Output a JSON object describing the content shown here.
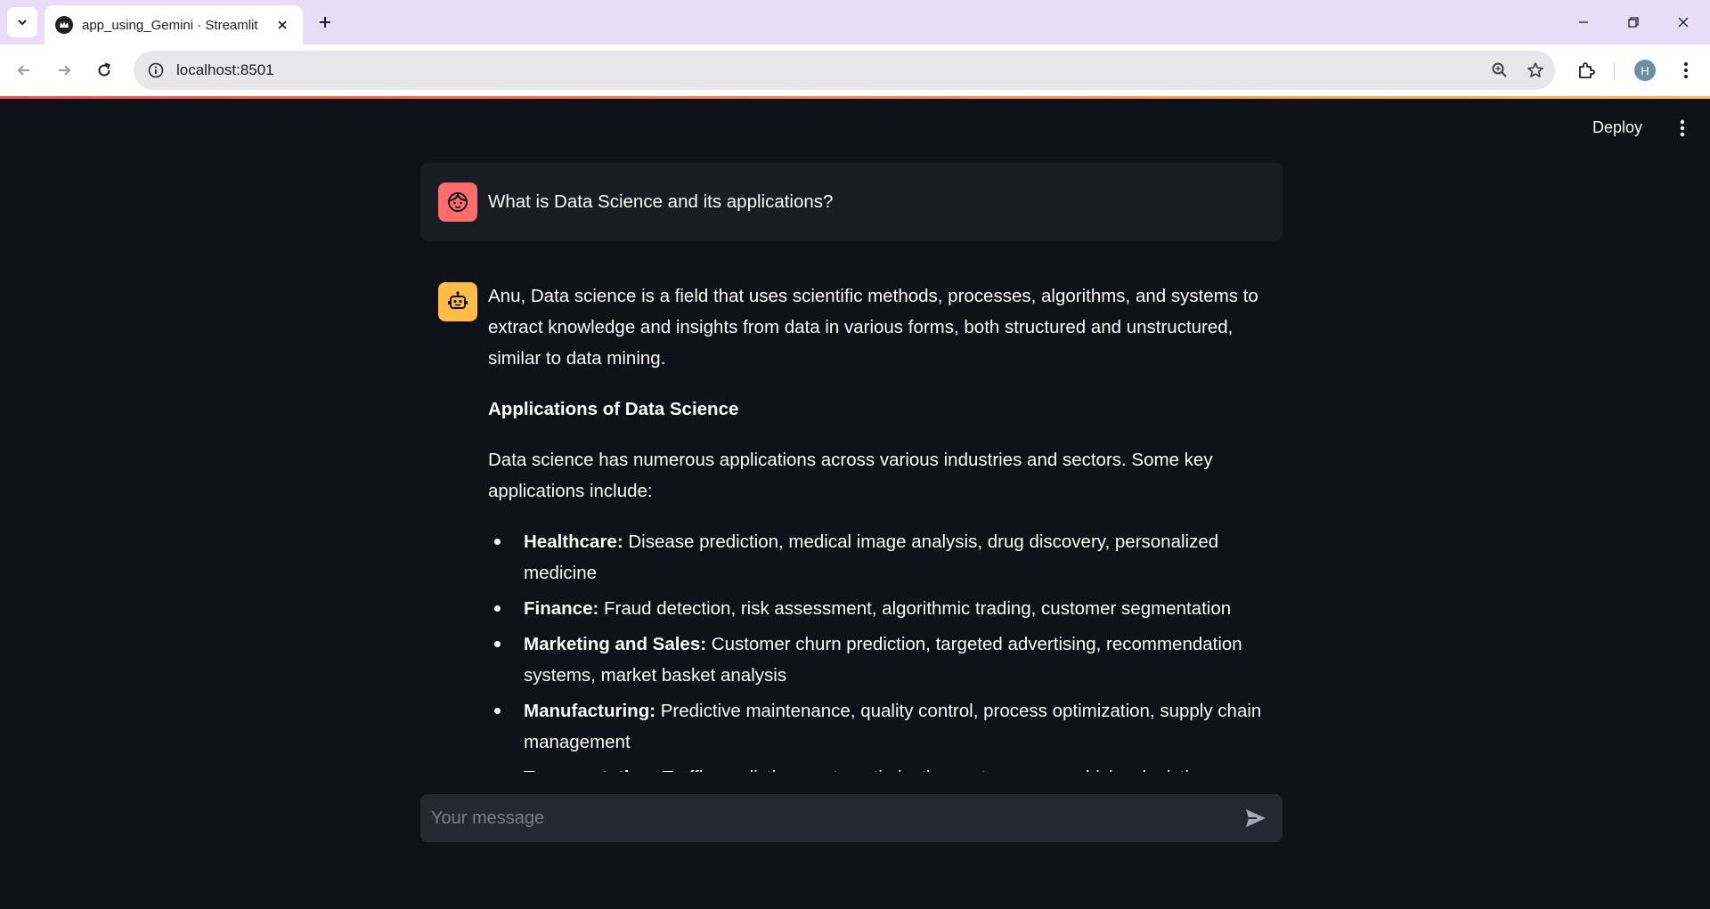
{
  "browser": {
    "tab_title": "app_using_Gemini · Streamlit",
    "url": "localhost:8501",
    "profile_initial": "H"
  },
  "app": {
    "deploy_label": "Deploy",
    "accent_gradient": [
      "#ff4b4b",
      "#ffbd45"
    ],
    "input_placeholder": "Your message"
  },
  "messages": {
    "user": {
      "text": "What is Data Science and its applications?",
      "avatar_icon": "user-face-icon",
      "avatar_color": "#ff6c6c"
    },
    "assistant": {
      "avatar_icon": "robot-icon",
      "avatar_color": "#ffbd45",
      "intro": "Anu, Data science is a field that uses scientific methods, processes, algorithms, and systems to extract knowledge and insights from data in various forms, both structured and unstructured, similar to data mining.",
      "heading": "Applications of Data Science",
      "para": "Data science has numerous applications across various industries and sectors. Some key applications include:",
      "items": [
        {
          "title": "Healthcare:",
          "text": " Disease prediction, medical image analysis, drug discovery, personalized medicine"
        },
        {
          "title": "Finance:",
          "text": " Fraud detection, risk assessment, algorithmic trading, customer segmentation"
        },
        {
          "title": "Marketing and Sales:",
          "text": " Customer churn prediction, targeted advertising, recommendation systems, market basket analysis"
        },
        {
          "title": "Manufacturing:",
          "text": " Predictive maintenance, quality control, process optimization, supply chain management"
        },
        {
          "title": "Transportation:",
          "text": " Traffic prediction, route optimization, autonomous vehicles, logistics"
        }
      ]
    }
  }
}
